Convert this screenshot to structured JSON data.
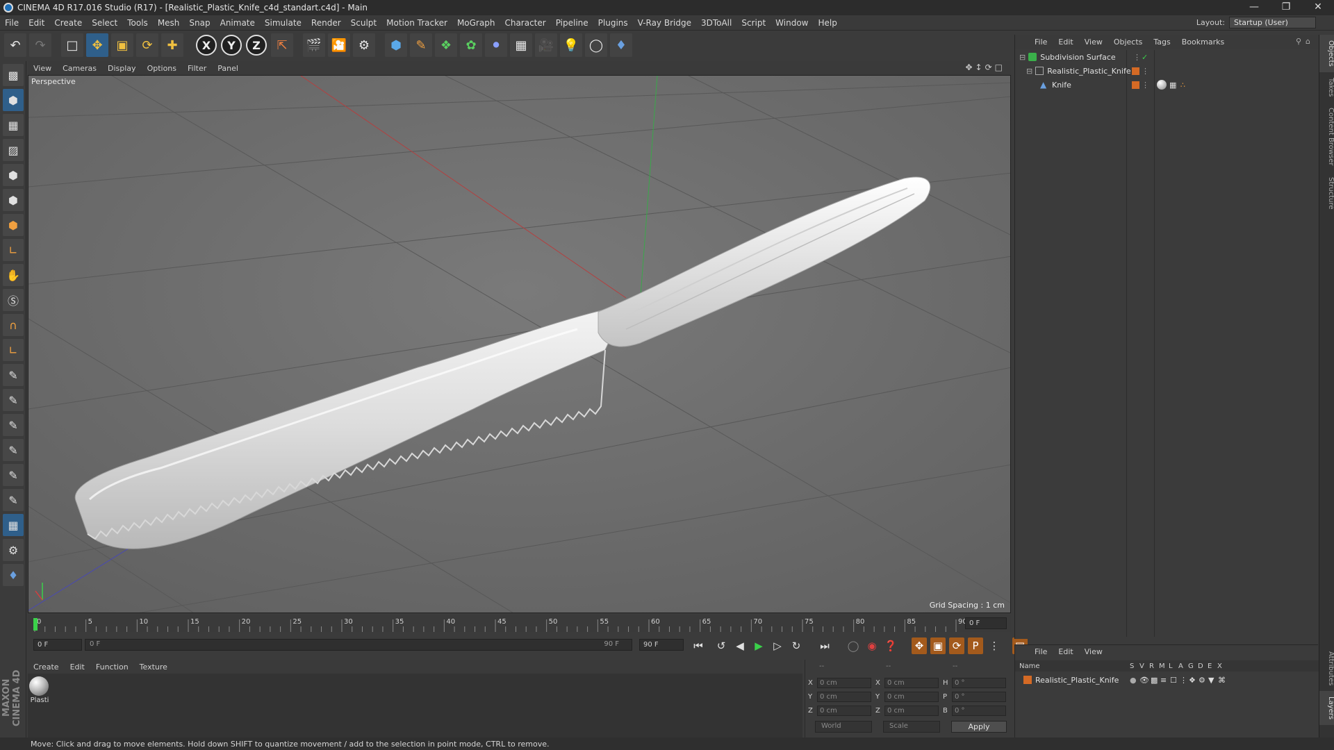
{
  "window": {
    "title": "CINEMA 4D R17.016 Studio (R17) - [Realistic_Plastic_Knife_c4d_standart.c4d] - Main",
    "min_icon": "minimize-icon",
    "max_icon": "restore-icon",
    "close_icon": "close-icon"
  },
  "menubar": {
    "items": [
      "File",
      "Edit",
      "Create",
      "Select",
      "Tools",
      "Mesh",
      "Snap",
      "Animate",
      "Simulate",
      "Render",
      "Sculpt",
      "Motion Tracker",
      "MoGraph",
      "Character",
      "Pipeline",
      "Plugins",
      "V-Ray Bridge",
      "3DToAll",
      "Script",
      "Window",
      "Help"
    ],
    "layout_label": "Layout:",
    "layout_value": "Startup (User)"
  },
  "viewport": {
    "menu": [
      "View",
      "Cameras",
      "Display",
      "Options",
      "Filter",
      "Panel"
    ],
    "label": "Perspective",
    "grid_spacing": "Grid Spacing : 1 cm"
  },
  "timeline": {
    "ticks": [
      "0",
      "5",
      "10",
      "15",
      "20",
      "25",
      "30",
      "35",
      "40",
      "45",
      "50",
      "55",
      "60",
      "65",
      "70",
      "75",
      "80",
      "85",
      "90"
    ],
    "current_frame": "0 F",
    "start_field": "0 F",
    "range_start": "0 F",
    "range_end": "90 F",
    "end_field": "90 F"
  },
  "materials": {
    "menu": [
      "Create",
      "Edit",
      "Function",
      "Texture"
    ],
    "items": [
      {
        "name": "Plasti"
      }
    ]
  },
  "coords": {
    "header": [
      "--",
      "--",
      "--"
    ],
    "rows": [
      {
        "a": "X",
        "av": "0 cm",
        "b": "X",
        "bv": "0 cm",
        "c": "H",
        "cv": "0 °"
      },
      {
        "a": "Y",
        "av": "0 cm",
        "b": "Y",
        "bv": "0 cm",
        "c": "P",
        "cv": "0 °"
      },
      {
        "a": "Z",
        "av": "0 cm",
        "b": "Z",
        "bv": "0 cm",
        "c": "B",
        "cv": "0 °"
      }
    ],
    "world": "World",
    "scale": "Scale",
    "apply": "Apply"
  },
  "objects": {
    "menu": [
      "File",
      "Edit",
      "View",
      "Objects",
      "Tags",
      "Bookmarks"
    ],
    "tree": [
      {
        "name": "Subdivision Surface",
        "indent": 0
      },
      {
        "name": "Realistic_Plastic_Knife",
        "indent": 1
      },
      {
        "name": "Knife",
        "indent": 2
      }
    ]
  },
  "layers": {
    "menu": [
      "File",
      "Edit",
      "View"
    ],
    "columns": [
      "Name",
      "S",
      "V",
      "R",
      "M",
      "L",
      "A",
      "G",
      "D",
      "E",
      "X"
    ],
    "rows": [
      {
        "name": "Realistic_Plastic_Knife"
      }
    ]
  },
  "right_tabs": [
    "Objects",
    "Takes",
    "Content Browser",
    "Structure",
    "Attributes",
    "Layers"
  ],
  "status": "Move: Click and drag to move elements. Hold down SHIFT to quantize movement / add to the selection in point mode, CTRL to remove.",
  "brand": "MAXON CINEMA 4D",
  "colors": {
    "accent": "#2f5f8a",
    "tag_orange": "#d46a25",
    "timeline_marker": "#3bd14a"
  }
}
